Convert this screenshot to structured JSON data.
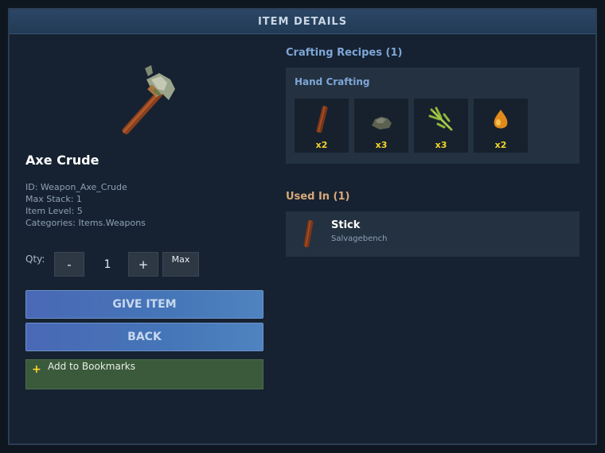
{
  "window": {
    "title": "ITEM DETAILS"
  },
  "item": {
    "name": "Axe Crude",
    "icon": "crude-axe-icon",
    "meta": [
      "ID: Weapon_Axe_Crude",
      "Max Stack: 1",
      "Item Level: 5",
      "Categories: Items.Weapons"
    ]
  },
  "quantity": {
    "label": "Qty:",
    "value": "1",
    "minus_label": "-",
    "plus_label": "+",
    "max_label": "Max"
  },
  "actions": {
    "give_label": "GIVE ITEM",
    "back_label": "BACK",
    "bookmark_icon": "+",
    "bookmark_label": "Add to Bookmarks"
  },
  "crafting": {
    "title": "Crafting Recipes (1)",
    "recipes": [
      {
        "station": "Hand Crafting",
        "ingredients": [
          {
            "icon": "stick-icon",
            "count": "x2"
          },
          {
            "icon": "rock-icon",
            "count": "x3"
          },
          {
            "icon": "plant-fiber-icon",
            "count": "x3"
          },
          {
            "icon": "tree-sap-icon",
            "count": "x2"
          }
        ]
      }
    ]
  },
  "used_in": {
    "title": "Used In (1)",
    "items": [
      {
        "name": "Stick",
        "station": "Salvagebench",
        "icon": "stick-icon"
      }
    ]
  },
  "colors": {
    "accent_blue": "#7ea6d6",
    "accent_orange": "#d8a878",
    "count_yellow": "#f2d42a",
    "button_blue": "#4a72b8",
    "bookmark_green": "#3b5a3c"
  }
}
